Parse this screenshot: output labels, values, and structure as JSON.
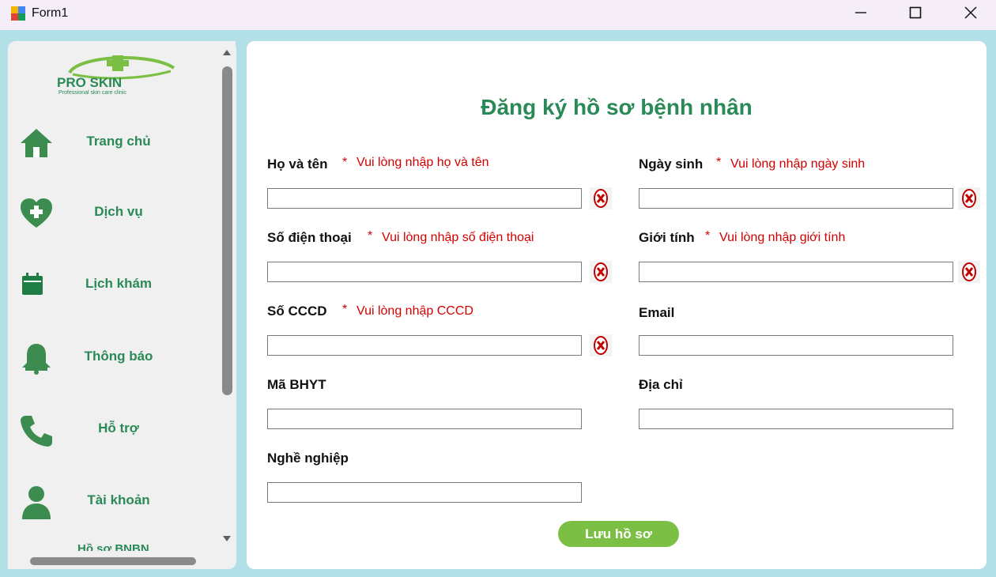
{
  "window": {
    "title": "Form1"
  },
  "logo": {
    "brand": "PRO SKIN",
    "tagline": "Professional skin care clinic"
  },
  "sidebar": {
    "items": [
      {
        "label": "Trang chủ",
        "icon": "home-icon"
      },
      {
        "label": "Dịch vụ",
        "icon": "heart-plus-icon"
      },
      {
        "label": "Lịch khám",
        "icon": "calendar-icon"
      },
      {
        "label": "Thông báo",
        "icon": "bell-icon"
      },
      {
        "label": "Hỗ trợ",
        "icon": "phone-icon"
      },
      {
        "label": "Tài khoản",
        "icon": "user-icon"
      }
    ],
    "partial_item": "Hồ sơ BNBN"
  },
  "form": {
    "title": "Đăng ký hồ sơ bệnh nhân",
    "required_mark": "*",
    "fields": {
      "full_name": {
        "label": "Họ và tên",
        "error": "Vui lòng nhập họ và tên",
        "value": ""
      },
      "dob": {
        "label": "Ngày sinh",
        "error": "Vui lòng nhập ngày sinh",
        "value": ""
      },
      "phone": {
        "label": "Số điện thoại",
        "error": "Vui lòng nhập số điện thoại",
        "value": ""
      },
      "gender": {
        "label": "Giới tính",
        "error": "Vui lòng nhập giới tính",
        "value": ""
      },
      "cccd": {
        "label": "Số CCCD",
        "error": "Vui lòng nhập CCCD",
        "value": ""
      },
      "email": {
        "label": "Email",
        "value": ""
      },
      "bhyt": {
        "label": "Mã BHYT",
        "value": ""
      },
      "address": {
        "label": "Địa chỉ",
        "value": ""
      },
      "occupation": {
        "label": "Nghề nghiệp",
        "value": ""
      }
    },
    "save_label": "Lưu hồ sơ"
  },
  "colors": {
    "brand_green": "#2a8a57",
    "button_green": "#7bbf44",
    "error_red": "#d40000",
    "window_bg": "#b3e0e6"
  }
}
